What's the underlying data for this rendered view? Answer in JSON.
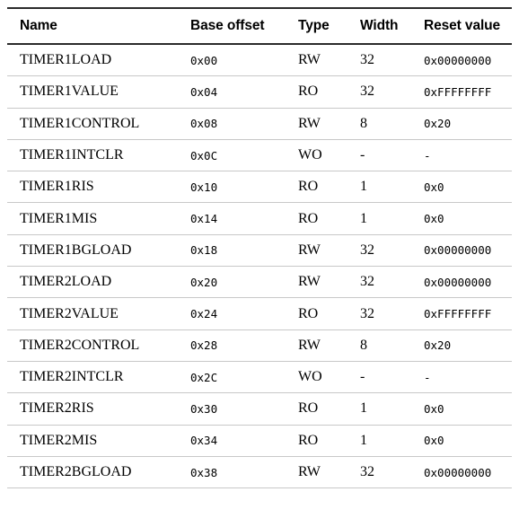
{
  "table": {
    "name": "register-summary-table",
    "columns": [
      {
        "key": "name",
        "label": "Name"
      },
      {
        "key": "offset",
        "label": "Base offset"
      },
      {
        "key": "type",
        "label": "Type"
      },
      {
        "key": "width",
        "label": "Width"
      },
      {
        "key": "reset",
        "label": "Reset value"
      }
    ],
    "rows": [
      {
        "name": "TIMER1LOAD",
        "offset": "0x00",
        "type": "RW",
        "width": "32",
        "reset": "0x00000000"
      },
      {
        "name": "TIMER1VALUE",
        "offset": "0x04",
        "type": "RO",
        "width": "32",
        "reset": "0xFFFFFFFF"
      },
      {
        "name": "TIMER1CONTROL",
        "offset": "0x08",
        "type": "RW",
        "width": "8",
        "reset": "0x20"
      },
      {
        "name": "TIMER1INTCLR",
        "offset": "0x0C",
        "type": "WO",
        "width": "-",
        "reset": "-"
      },
      {
        "name": "TIMER1RIS",
        "offset": "0x10",
        "type": "RO",
        "width": "1",
        "reset": "0x0"
      },
      {
        "name": "TIMER1MIS",
        "offset": "0x14",
        "type": "RO",
        "width": "1",
        "reset": "0x0"
      },
      {
        "name": "TIMER1BGLOAD",
        "offset": "0x18",
        "type": "RW",
        "width": "32",
        "reset": "0x00000000"
      },
      {
        "name": "TIMER2LOAD",
        "offset": "0x20",
        "type": "RW",
        "width": "32",
        "reset": "0x00000000"
      },
      {
        "name": "TIMER2VALUE",
        "offset": "0x24",
        "type": "RO",
        "width": "32",
        "reset": "0xFFFFFFFF"
      },
      {
        "name": "TIMER2CONTROL",
        "offset": "0x28",
        "type": "RW",
        "width": "8",
        "reset": "0x20"
      },
      {
        "name": "TIMER2INTCLR",
        "offset": "0x2C",
        "type": "WO",
        "width": "-",
        "reset": "-"
      },
      {
        "name": "TIMER2RIS",
        "offset": "0x30",
        "type": "RO",
        "width": "1",
        "reset": "0x0"
      },
      {
        "name": "TIMER2MIS",
        "offset": "0x34",
        "type": "RO",
        "width": "1",
        "reset": "0x0"
      },
      {
        "name": "TIMER2BGLOAD",
        "offset": "0x38",
        "type": "RW",
        "width": "32",
        "reset": "0x00000000"
      }
    ]
  },
  "colors": {
    "page_background": "#ffffff",
    "text": "#000000",
    "header_rule": "#2b2b2b",
    "row_rule": "#c8c8c8"
  }
}
